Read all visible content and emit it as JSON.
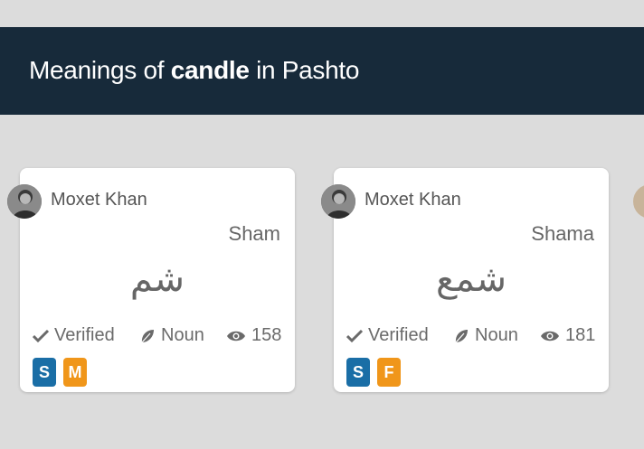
{
  "page": {
    "title_prefix": "Meanings of ",
    "title_word": "candle",
    "title_suffix": " in Pashto"
  },
  "cards": [
    {
      "author": "Moxet Khan",
      "transliteration": "Sham",
      "native": "شم",
      "status": "Verified",
      "part_of_speech": "Noun",
      "views": "158",
      "badges": [
        "S",
        "M"
      ]
    },
    {
      "author": "Moxet Khan",
      "transliteration": "Shama",
      "native": "شمع",
      "status": "Verified",
      "part_of_speech": "Noun",
      "views": "181",
      "badges": [
        "S",
        "F"
      ]
    }
  ],
  "icons": {
    "verified": "check-icon",
    "part_of_speech": "leaf-icon",
    "views": "eye-icon"
  },
  "colors": {
    "header_bg": "#172a3a",
    "badge_s": "#1a6ea6",
    "badge_gender": "#f0961a",
    "page_bg": "#dcdcdc"
  }
}
